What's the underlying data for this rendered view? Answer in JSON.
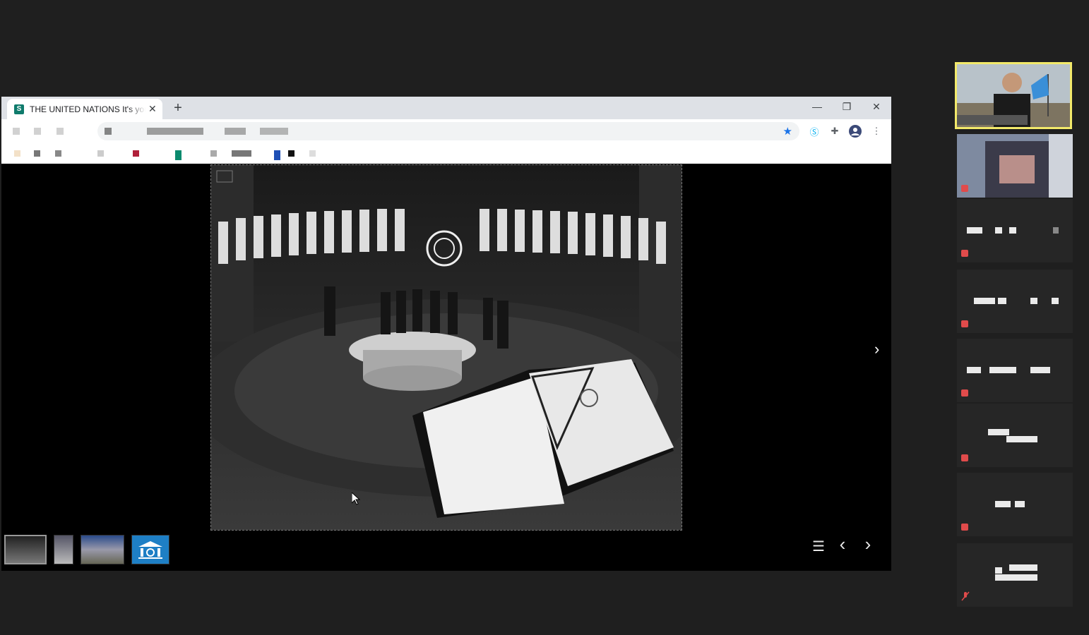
{
  "browser": {
    "tab": {
      "title": "THE UNITED NATIONS It's your w",
      "favicon_letter": "S",
      "close_label": "✕"
    },
    "new_tab_label": "+",
    "window_controls": {
      "minimize": "—",
      "restore": "❐",
      "close": "✕"
    },
    "toolbar": {
      "bookmark_icon": "star-icon",
      "menu_label": "⋮"
    }
  },
  "viewer": {
    "thumbnails": [
      "charter-signing",
      "secretary-general",
      "un-headquarters",
      "un-building-logo"
    ],
    "controls": {
      "list": "☰",
      "prev": "‹",
      "next": "›"
    },
    "next_large": "›"
  },
  "participants": {
    "count_visible": 8,
    "accent_color": "#f2e96a"
  }
}
